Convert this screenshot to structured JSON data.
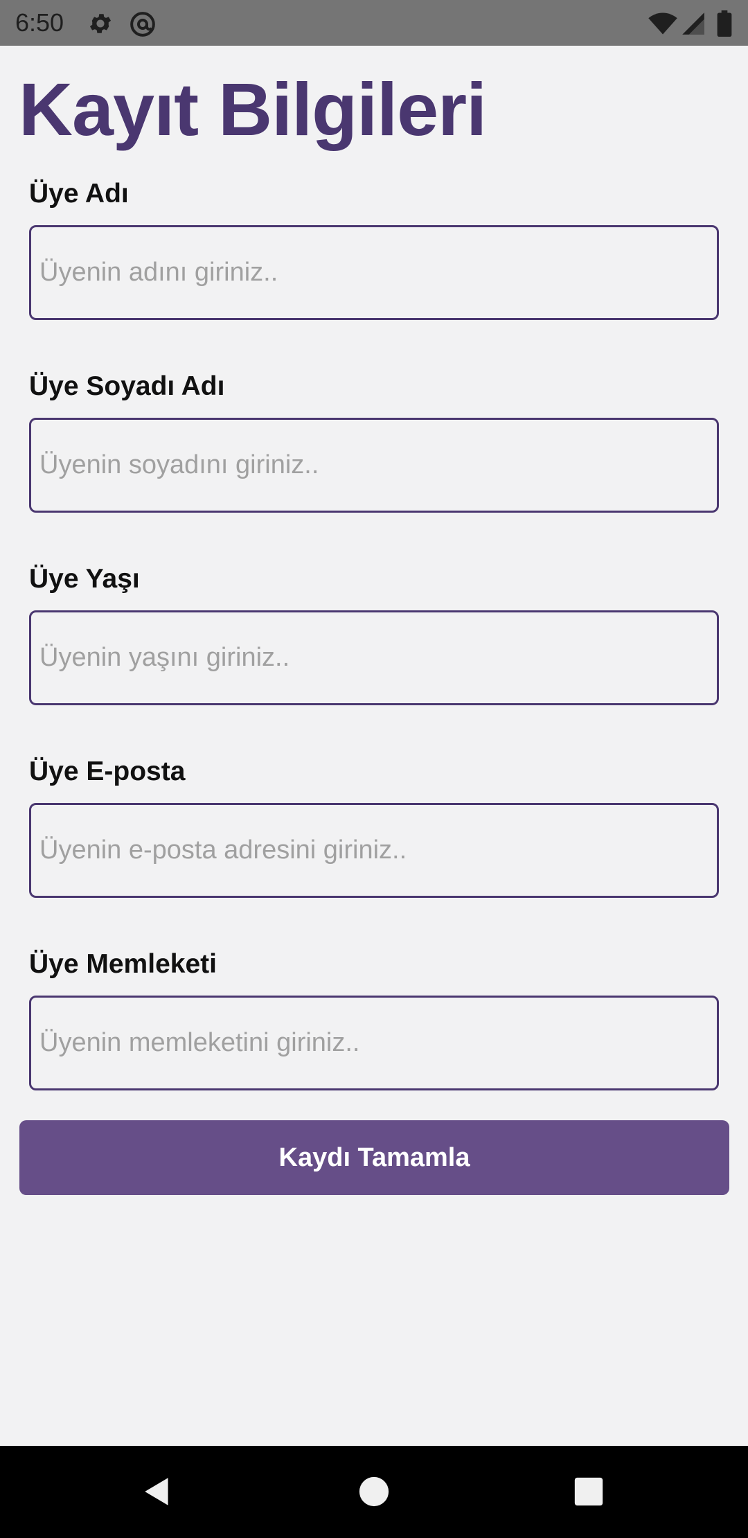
{
  "status_bar": {
    "time": "6:50",
    "icons": [
      "settings-icon",
      "at-sign-icon",
      "wifi-icon",
      "signal-icon",
      "battery-icon"
    ]
  },
  "page": {
    "title": "Kayıt Bilgileri"
  },
  "form": {
    "fields": [
      {
        "label": "Üye Adı",
        "placeholder": "Üyenin adını giriniz..",
        "value": ""
      },
      {
        "label": "Üye Soyadı Adı",
        "placeholder": "Üyenin soyadını giriniz..",
        "value": ""
      },
      {
        "label": "Üye Yaşı",
        "placeholder": "Üyenin yaşını giriniz..",
        "value": ""
      },
      {
        "label": "Üye E-posta",
        "placeholder": "Üyenin e-posta adresini giriniz..",
        "value": ""
      },
      {
        "label": "Üye Memleketi",
        "placeholder": "Üyenin memleketini giriniz..",
        "value": ""
      }
    ],
    "submit_label": "Kaydı Tamamla"
  },
  "nav_bar": {
    "buttons": [
      "back-icon",
      "home-icon",
      "recents-icon"
    ]
  },
  "colors": {
    "accent": "#4a3770",
    "button": "#664e88",
    "background": "#f2f2f3"
  }
}
